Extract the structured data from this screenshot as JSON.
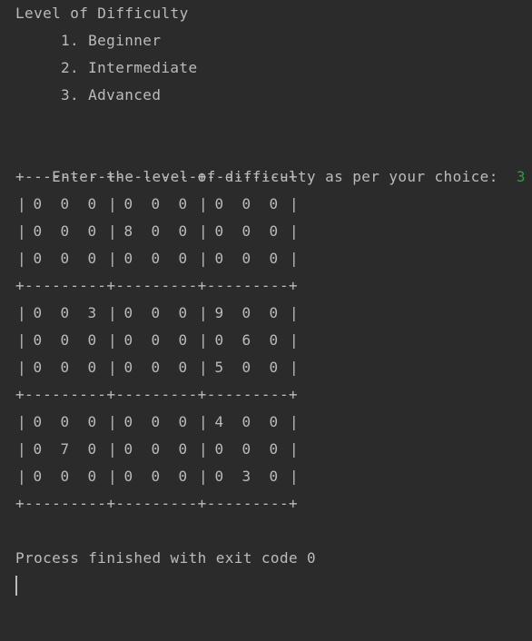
{
  "console": {
    "heading": "Level of Difficulty",
    "options": [
      "1. Beginner",
      "2. Intermediate",
      "3. Advanced"
    ],
    "prompt": "Enter the level of difficulty as per your choice:",
    "user_input": "3",
    "separator": "+---------+---------+---------+",
    "board": [
      [
        [
          "0",
          "0",
          "0"
        ],
        [
          "0",
          "0",
          "0"
        ],
        [
          "0",
          "0",
          "0"
        ]
      ],
      [
        [
          "0",
          "0",
          "0"
        ],
        [
          "8",
          "0",
          "0"
        ],
        [
          "0",
          "0",
          "0"
        ]
      ],
      [
        [
          "0",
          "0",
          "0"
        ],
        [
          "0",
          "0",
          "0"
        ],
        [
          "0",
          "0",
          "0"
        ]
      ],
      [
        [
          "0",
          "0",
          "3"
        ],
        [
          "0",
          "0",
          "0"
        ],
        [
          "9",
          "0",
          "0"
        ]
      ],
      [
        [
          "0",
          "0",
          "0"
        ],
        [
          "0",
          "0",
          "0"
        ],
        [
          "0",
          "6",
          "0"
        ]
      ],
      [
        [
          "0",
          "0",
          "0"
        ],
        [
          "0",
          "0",
          "0"
        ],
        [
          "5",
          "0",
          "0"
        ]
      ],
      [
        [
          "0",
          "0",
          "0"
        ],
        [
          "0",
          "0",
          "0"
        ],
        [
          "4",
          "0",
          "0"
        ]
      ],
      [
        [
          "0",
          "7",
          "0"
        ],
        [
          "0",
          "0",
          "0"
        ],
        [
          "0",
          "0",
          "0"
        ]
      ],
      [
        [
          "0",
          "0",
          "0"
        ],
        [
          "0",
          "0",
          "0"
        ],
        [
          "0",
          "3",
          "0"
        ]
      ]
    ],
    "exit_message": "Process finished with exit code 0"
  },
  "colors": {
    "background": "#2b2b2b",
    "text": "#bbbbbb",
    "user_input": "#2f9e3f"
  }
}
